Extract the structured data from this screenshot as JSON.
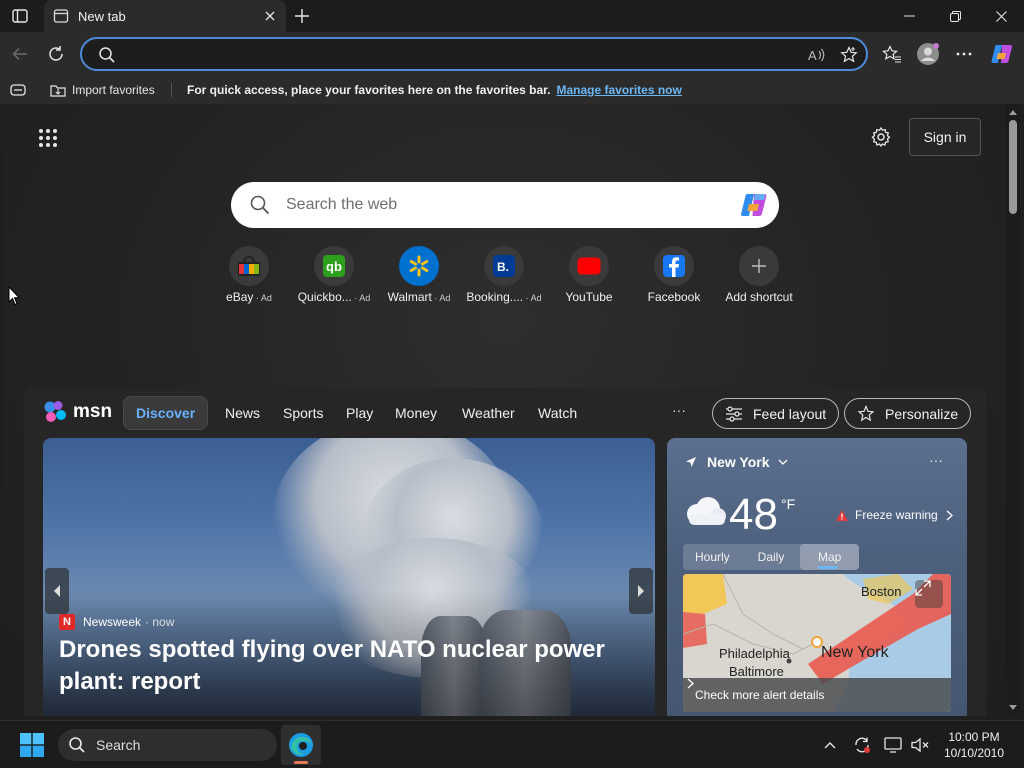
{
  "browser": {
    "tab_title": "New tab",
    "address_value": "",
    "colors": {
      "accent": "#4c8bd9",
      "link": "#6cb8f5"
    }
  },
  "favorites_bar": {
    "import_label": "Import favorites",
    "message": "For quick access, place your favorites here on the favorites bar.",
    "manage_link": "Manage favorites now"
  },
  "page": {
    "signin_label": "Sign in",
    "search_placeholder": "Search the web",
    "shortcuts": [
      {
        "label": "eBay",
        "ad": "Ad",
        "icon": "ebay-icon"
      },
      {
        "label": "Quickbo...",
        "ad": "Ad",
        "icon": "quickbooks-icon"
      },
      {
        "label": "Walmart",
        "ad": "Ad",
        "icon": "walmart-icon"
      },
      {
        "label": "Booking....",
        "ad": "Ad",
        "icon": "booking-icon"
      },
      {
        "label": "YouTube",
        "ad": "",
        "icon": "youtube-icon"
      },
      {
        "label": "Facebook",
        "ad": "",
        "icon": "facebook-icon"
      },
      {
        "label": "Add shortcut",
        "ad": "",
        "icon": "plus-icon"
      }
    ]
  },
  "msn": {
    "logo_text": "msn",
    "nav": [
      "Discover",
      "News",
      "Sports",
      "Play",
      "Money",
      "Weather",
      "Watch"
    ],
    "more": "···",
    "feed_layout_label": "Feed layout",
    "personalize_label": "Personalize",
    "hero": {
      "source_logo": "N",
      "source": "Newsweek",
      "time": "· now",
      "title": "Drones spotted flying over NATO nuclear power plant: report"
    },
    "weather": {
      "location": "New York",
      "more": "···",
      "temperature": "48",
      "unit": "°F",
      "alert": "Freeze warning",
      "tabs": [
        "Hourly",
        "Daily",
        "Map"
      ],
      "active_tab": "Map",
      "map_labels": {
        "boston": "Boston",
        "philadelphia": "Philadelphia",
        "baltimore": "Baltimore",
        "new_york": "New York"
      },
      "alert_link": "Check more alert details"
    }
  },
  "taskbar": {
    "search_label": "Search",
    "time": "10:00 PM",
    "date": "10/10/2010"
  }
}
